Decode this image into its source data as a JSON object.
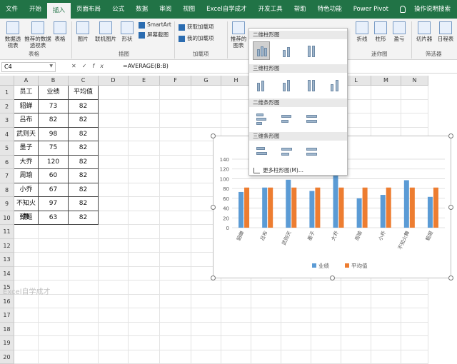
{
  "ribbon_tabs": [
    "文件",
    "开始",
    "插入",
    "页面布局",
    "公式",
    "数据",
    "审阅",
    "视图",
    "Excel自学成才",
    "开发工具",
    "帮助",
    "特色功能",
    "Power Pivot",
    "操作说明搜索"
  ],
  "active_tab": "插入",
  "ribbon": {
    "pivot": "数据透视表",
    "recommended_pivot": "推荐的数据透视表",
    "table": "表格",
    "group_tables": "表格",
    "pictures": "图片",
    "online_pictures": "联机图片",
    "shapes": "形状",
    "smartart": "SmartArt",
    "screenshot": "屏幕截图",
    "group_illustrations": "插图",
    "get_addins": "获取加载项",
    "my_addins": "我的加载项",
    "group_addins": "加载项",
    "recommended_charts": "推荐的图表",
    "line": "折线",
    "column": "柱形",
    "winloss": "盈亏",
    "group_sparklines": "迷你图",
    "slicer": "切片器",
    "timeline": "日程表",
    "group_filters": "筛选器"
  },
  "formula_bar": {
    "name_box": "C4",
    "formula": "=AVERAGE(B:B)"
  },
  "columns": [
    "A",
    "B",
    "C",
    "D",
    "E",
    "F",
    "G",
    "H",
    "I",
    "J",
    "K",
    "L",
    "M",
    "N"
  ],
  "rows": [
    "1",
    "2",
    "3",
    "4",
    "5",
    "6",
    "7",
    "8",
    "9",
    "10",
    "11",
    "12",
    "13",
    "14",
    "15",
    "16",
    "17",
    "18",
    "19",
    "20"
  ],
  "table": {
    "headers": [
      "员工",
      "业绩",
      "平均值"
    ],
    "names": [
      "貂蝉",
      "吕布",
      "武则天",
      "墨子",
      "大乔",
      "周瑜",
      "小乔",
      "不知火舞",
      "甄姬"
    ],
    "sales": [
      "73",
      "82",
      "98",
      "75",
      "120",
      "60",
      "67",
      "97",
      "63"
    ],
    "avg": [
      "82",
      "82",
      "82",
      "82",
      "82",
      "82",
      "82",
      "82",
      "82"
    ]
  },
  "chart_menu": {
    "sections": [
      "二维柱形图",
      "三维柱形图",
      "二维条形图",
      "三维条形图"
    ],
    "more": "更多柱形图(M)..."
  },
  "chart_data": {
    "type": "bar",
    "title": "",
    "categories": [
      "貂蝉",
      "吕布",
      "武则天",
      "墨子",
      "大乔",
      "周瑜",
      "小乔",
      "不知火舞",
      "甄姬"
    ],
    "series": [
      {
        "name": "业绩",
        "values": [
          73,
          82,
          98,
          75,
          120,
          60,
          67,
          97,
          63
        ],
        "color": "#5b9bd5"
      },
      {
        "name": "平均值",
        "values": [
          82,
          82,
          82,
          82,
          82,
          82,
          82,
          82,
          82
        ],
        "color": "#ed7d31"
      }
    ],
    "ylim": [
      0,
      140
    ],
    "yticks": [
      "0",
      "20",
      "40",
      "60",
      "80",
      "100",
      "120",
      "140"
    ],
    "grid": true,
    "legend": "bottom"
  },
  "watermark": "Excel自学成才"
}
